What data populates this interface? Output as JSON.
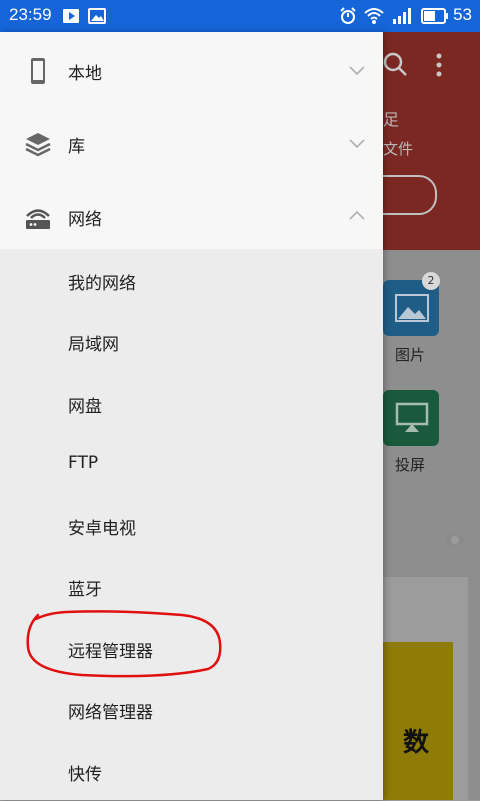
{
  "status_bar": {
    "time": "23:59",
    "battery": "53"
  },
  "background_app": {
    "header_text_1": "足",
    "header_text_2": "文件",
    "tiles": [
      {
        "label": "图片",
        "badge": "2",
        "color": "#1f5d86"
      },
      {
        "label": "投屏",
        "color": "#1a5a3c"
      }
    ],
    "partial_text": "数"
  },
  "drawer": {
    "categories": [
      {
        "label": "本地",
        "icon": "phone-icon",
        "expanded": false
      },
      {
        "label": "库",
        "icon": "layers-icon",
        "expanded": false
      },
      {
        "label": "网络",
        "icon": "router-icon",
        "expanded": true
      }
    ],
    "network_items": [
      {
        "label": "我的网络"
      },
      {
        "label": "局域网"
      },
      {
        "label": "网盘"
      },
      {
        "label": "FTP"
      },
      {
        "label": "安卓电视"
      },
      {
        "label": "蓝牙"
      },
      {
        "label": "远程管理器",
        "circled": true
      },
      {
        "label": "网络管理器"
      },
      {
        "label": "快传"
      }
    ]
  },
  "colors": {
    "status_bar": "#1565d8",
    "drawer_bg": "#ececec",
    "annotation": "#e01010"
  }
}
